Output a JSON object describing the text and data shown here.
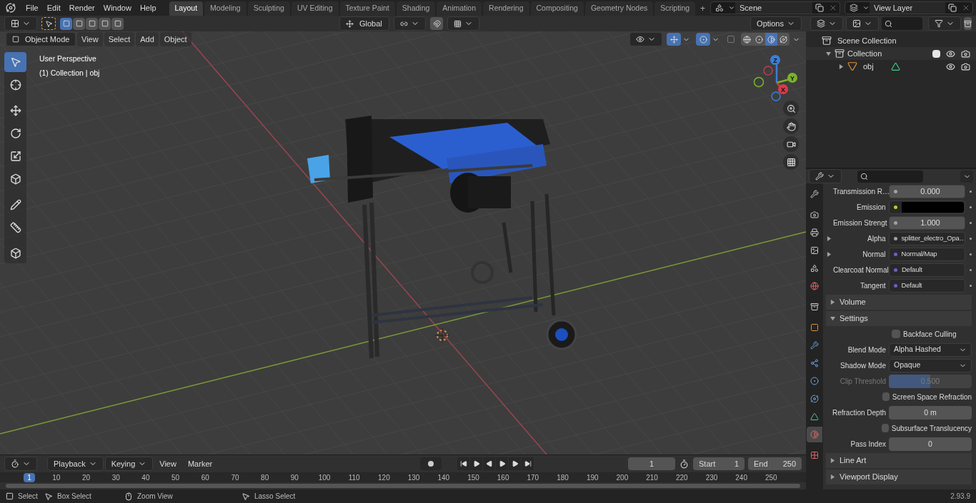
{
  "menu": [
    "File",
    "Edit",
    "Render",
    "Window",
    "Help"
  ],
  "workspaces": [
    {
      "label": "Layout",
      "selected": true
    },
    {
      "label": "Modeling",
      "selected": false
    },
    {
      "label": "Sculpting",
      "selected": false
    },
    {
      "label": "UV Editing",
      "selected": false
    },
    {
      "label": "Texture Paint",
      "selected": false
    },
    {
      "label": "Shading",
      "selected": false
    },
    {
      "label": "Animation",
      "selected": false
    },
    {
      "label": "Rendering",
      "selected": false
    },
    {
      "label": "Compositing",
      "selected": false
    },
    {
      "label": "Geometry Nodes",
      "selected": false
    },
    {
      "label": "Scripting",
      "selected": false
    }
  ],
  "add_workspace": "+",
  "scene": "Scene",
  "view_layer": "View Layer",
  "viewport": {
    "selection_modes": [
      {
        "selected": true
      },
      {
        "selected": false
      },
      {
        "selected": false
      },
      {
        "selected": false
      },
      {
        "selected": false
      }
    ],
    "transform_orientation": "Global",
    "options": "Options",
    "mode": "Object Mode",
    "menus": [
      "View",
      "Select",
      "Add",
      "Object"
    ],
    "shading": [
      {
        "kind": "wireframe",
        "selected": false
      },
      {
        "kind": "solid",
        "selected": false
      },
      {
        "kind": "material",
        "selected": true
      },
      {
        "kind": "rendered",
        "selected": false
      }
    ],
    "overlay_text": [
      "User Perspective",
      "(1) Collection | obj"
    ],
    "tools": [
      {
        "kind": "select",
        "selected": true
      },
      {
        "kind": "cursor",
        "selected": false
      },
      {
        "kind": "move",
        "selected": false
      },
      {
        "kind": "rotate",
        "selected": false
      },
      {
        "kind": "scale",
        "selected": false
      },
      {
        "kind": "transform",
        "selected": false
      },
      {
        "kind": "annotate",
        "selected": false
      },
      {
        "kind": "measure",
        "selected": false
      },
      {
        "kind": "add-cube",
        "selected": false
      }
    ],
    "gizmo": {
      "z": "Z",
      "y": "Y",
      "x": "X"
    }
  },
  "outliner": {
    "items": [
      {
        "label": "Scene Collection",
        "children": [
          {
            "label": "Collection",
            "expanded": true,
            "checked": true,
            "children": [
              {
                "label": "obj",
                "expanded": false
              }
            ]
          }
        ]
      }
    ]
  },
  "properties": {
    "tabs": [
      {
        "kind": "tool",
        "selected": false
      },
      {
        "kind": "render",
        "selected": false
      },
      {
        "kind": "output",
        "selected": false
      },
      {
        "kind": "view-layer",
        "selected": false
      },
      {
        "kind": "scene",
        "selected": false
      },
      {
        "kind": "world",
        "selected": false
      },
      {
        "kind": "collection",
        "selected": false
      },
      {
        "kind": "object",
        "selected": false
      },
      {
        "kind": "modifiers",
        "selected": false
      },
      {
        "kind": "particles",
        "selected": false
      },
      {
        "kind": "physics",
        "selected": false
      },
      {
        "kind": "constraints",
        "selected": false
      },
      {
        "kind": "data",
        "selected": false
      },
      {
        "kind": "material",
        "selected": true
      },
      {
        "kind": "texture",
        "selected": false
      }
    ],
    "sockets": [
      {
        "label": "Transmission R…",
        "kind": "number",
        "value": "0.000",
        "color": "#a1a1a1",
        "collapsed_input": false
      },
      {
        "label": "Emission",
        "kind": "swatch",
        "color": "#c7c729",
        "collapsed_input": false
      },
      {
        "label": "Emission Strengt",
        "kind": "number",
        "value": "1.000",
        "color": "#a1a1a1",
        "collapsed_input": false
      },
      {
        "label": "Alpha",
        "kind": "link",
        "value": "splitter_electro_Opa…",
        "color": "#a1a1a1",
        "collapsed_input": true
      },
      {
        "label": "Normal",
        "kind": "link",
        "value": "Normal/Map",
        "color": "#6363c7",
        "collapsed_input": true
      },
      {
        "label": "Clearcoat Normal",
        "kind": "link",
        "value": "Default",
        "color": "#6363c7",
        "collapsed_input": false
      },
      {
        "label": "Tangent",
        "kind": "link",
        "value": "Default",
        "color": "#6363c7",
        "collapsed_input": false
      }
    ],
    "panels": [
      {
        "title": "Volume",
        "expanded": false
      },
      {
        "title": "Settings",
        "expanded": true,
        "rows": [
          {
            "kind": "checkbox",
            "label": "Backface Culling",
            "checked": false
          },
          {
            "kind": "dropdown",
            "label": "Blend Mode",
            "value": "Alpha Hashed"
          },
          {
            "kind": "dropdown",
            "label": "Shadow Mode",
            "value": "Opaque"
          },
          {
            "kind": "slider",
            "label": "Clip Threshold",
            "value": "0.500",
            "level": 0.5,
            "disabled": true
          },
          {
            "kind": "checkbox",
            "label": "Screen Space Refraction",
            "checked": false
          },
          {
            "kind": "number",
            "label": "Refraction Depth",
            "value": "0 m"
          },
          {
            "kind": "checkbox",
            "label": "Subsurface Translucency",
            "checked": false
          },
          {
            "kind": "number",
            "label": "Pass Index",
            "value": "0"
          }
        ]
      },
      {
        "title": "Line Art",
        "expanded": false
      },
      {
        "title": "Viewport Display",
        "expanded": false
      }
    ]
  },
  "timeline": {
    "playback": "Playback",
    "keying": "Keying",
    "menus": [
      "View",
      "Marker"
    ],
    "current_frame": "1",
    "start_label": "Start",
    "start": "1",
    "end_label": "End",
    "end": "250",
    "playhead": "1",
    "ticks": [
      "10",
      "20",
      "30",
      "40",
      "50",
      "60",
      "70",
      "80",
      "90",
      "100",
      "110",
      "120",
      "130",
      "140",
      "150",
      "160",
      "170",
      "180",
      "190",
      "200",
      "210",
      "220",
      "230",
      "240",
      "250"
    ]
  },
  "status_bar": {
    "items": [
      {
        "kind": "left",
        "label": "Select"
      },
      {
        "kind": "drag",
        "label": "Box Select"
      },
      {
        "kind": "middle",
        "label": "Zoom View"
      },
      {
        "kind": "drag",
        "label": "Lasso Select"
      }
    ],
    "version": "2.93.9"
  }
}
